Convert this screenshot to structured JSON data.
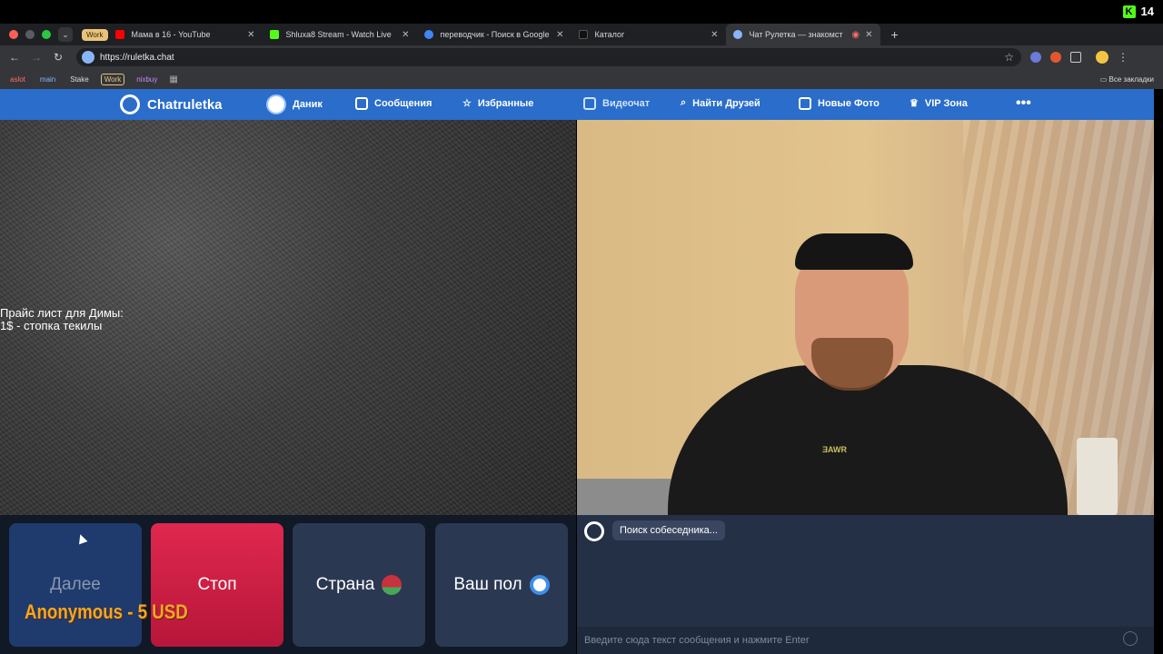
{
  "overlay": {
    "viewer_count": "14"
  },
  "browser": {
    "group_label": "Work",
    "tabs": [
      {
        "title": "Мама в 16 - YouTube",
        "color": "#ff0000"
      },
      {
        "title": "Shluxa8 Stream - Watch Live",
        "color": "#53fc18"
      },
      {
        "title": "переводчик - Поиск в Google",
        "color": "#4285f4"
      },
      {
        "title": "Каталог",
        "color": "#222222"
      },
      {
        "title": "Чат Рулетка — знакомст",
        "color": "#8ab4f8"
      }
    ],
    "url": "https://ruletka.chat",
    "bookmarks": [
      "aslot",
      "main",
      "Stake",
      "Work",
      "nixbuy"
    ],
    "all_bookmarks": "Все закладки"
  },
  "site": {
    "brand": "Chatruletka",
    "nav": {
      "user": "Даник",
      "messages": "Сообщения",
      "favorites": "Избранные",
      "videochat": "Видеочат",
      "find_friends": "Найти Друзей",
      "new_photos": "Новые Фото",
      "vip": "VIP Зона"
    },
    "more": "•••"
  },
  "video": {
    "price_line1": "Прайс лист для Димы:",
    "price_line2": "1$ - стопка текилы",
    "shirt_print": "ƎAWR"
  },
  "controls": {
    "next": "Далее",
    "stop": "Стоп",
    "country": "Страна",
    "gender": "Ваш пол"
  },
  "donation": "Anonymous - 5 USD",
  "chat": {
    "status": "Поиск собеседника...",
    "input_placeholder": "Введите сюда текст сообщения и нажмите Enter"
  }
}
